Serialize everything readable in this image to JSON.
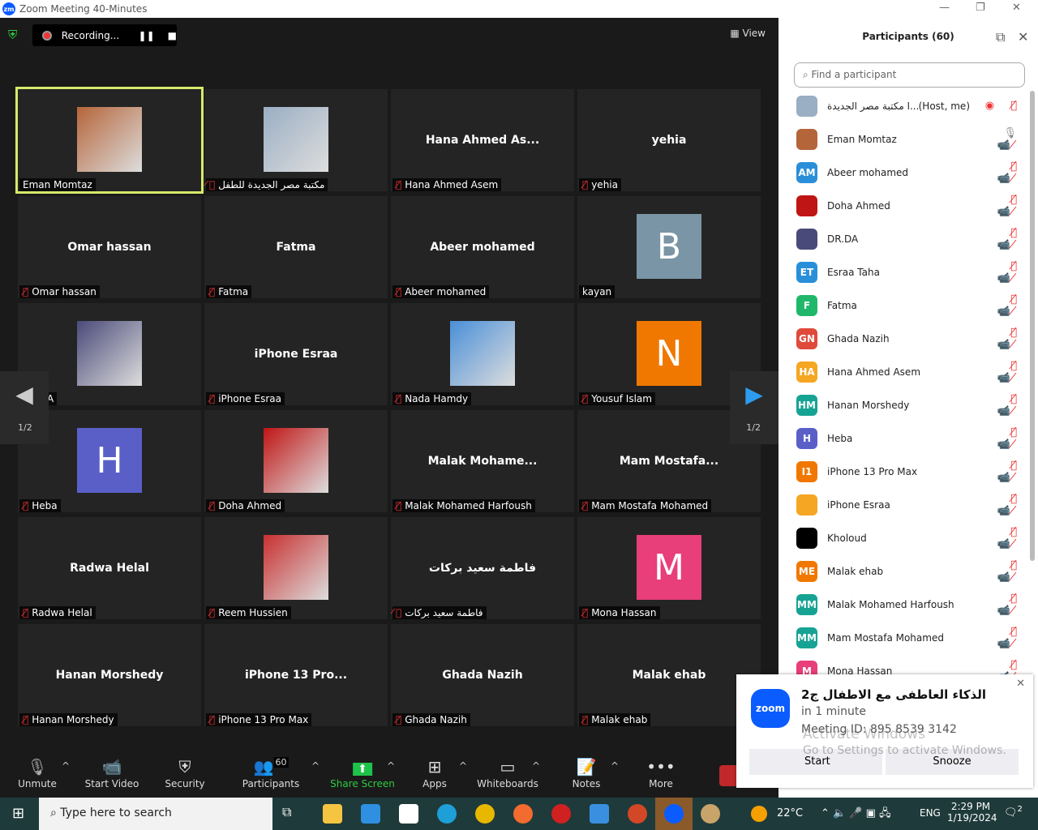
{
  "window": {
    "title": "Zoom Meeting 40-Minutes",
    "logo": "zm"
  },
  "topbar": {
    "recording": "Recording...",
    "view": "View"
  },
  "tiles": [
    {
      "label": "Eman Momtaz",
      "kind": "image",
      "color": "#b5653a",
      "active": true,
      "muted": false
    },
    {
      "label": "مكتبة مصر الجديدة للطفل",
      "kind": "image",
      "color": "#9aaec4",
      "muted": true
    },
    {
      "label": "Hana Ahmed Asem",
      "name": "Hana Ahmed As...",
      "kind": "name",
      "muted": true
    },
    {
      "label": "yehia",
      "name": "yehia",
      "kind": "name",
      "muted": true
    },
    {
      "label": "Omar hassan",
      "name": "Omar hassan",
      "kind": "name",
      "muted": true
    },
    {
      "label": "Fatma",
      "name": "Fatma",
      "kind": "name",
      "muted": true
    },
    {
      "label": "Abeer mohamed",
      "name": "Abeer mohamed",
      "kind": "name",
      "muted": true
    },
    {
      "label": "kayan",
      "kind": "letter",
      "letter": "B",
      "color": "#7a95a5",
      "muted": false
    },
    {
      "label": "DR.DA",
      "kind": "image",
      "color": "#4a4a7a",
      "muted": false
    },
    {
      "label": "iPhone Esraa",
      "name": "iPhone Esraa",
      "kind": "name",
      "muted": true
    },
    {
      "label": "Nada Hamdy",
      "kind": "image",
      "color": "#4a8fd8",
      "muted": true
    },
    {
      "label": "Yousuf Islam",
      "kind": "letter",
      "letter": "N",
      "color": "#f07800",
      "muted": true
    },
    {
      "label": "Heba",
      "kind": "letter",
      "letter": "H",
      "color": "#5a5fc8",
      "muted": true
    },
    {
      "label": "Doha Ahmed",
      "kind": "image",
      "color": "#c01515",
      "muted": true
    },
    {
      "label": "Malak Mohamed Harfoush",
      "name": "Malak  Mohame...",
      "kind": "name",
      "muted": true
    },
    {
      "label": "Mam Mostafa Mohamed",
      "name": "Mam  Mostafa...",
      "kind": "name",
      "muted": true
    },
    {
      "label": "Radwa Helal",
      "name": "Radwa Helal",
      "kind": "name",
      "muted": true
    },
    {
      "label": "Reem Hussien",
      "kind": "image",
      "color": "#c83030",
      "muted": true
    },
    {
      "label": "فاطمة سعيد بركات",
      "name": "فاطمة سعيد بركات",
      "kind": "name",
      "muted": true
    },
    {
      "label": "Mona Hassan",
      "kind": "letter",
      "letter": "M",
      "color": "#e83e7a",
      "muted": true
    },
    {
      "label": "Hanan Morshedy",
      "name": "Hanan Morshedy",
      "kind": "name",
      "muted": true
    },
    {
      "label": "iPhone 13 Pro Max",
      "name": "iPhone  13  Pro...",
      "kind": "name",
      "muted": true
    },
    {
      "label": "Ghada Nazih",
      "name": "Ghada Nazih",
      "kind": "name",
      "muted": true
    },
    {
      "label": "Malak ehab",
      "name": "Malak ehab",
      "kind": "name",
      "muted": true
    }
  ],
  "pager": {
    "left": "1/2",
    "right": "1/2"
  },
  "toolbar": [
    {
      "label": "Unmute",
      "icon": "mic-off-icon",
      "glyph": "🎙"
    },
    {
      "label": "Start Video",
      "icon": "video-off-icon",
      "glyph": "📹"
    },
    {
      "label": "Security",
      "icon": "shield-icon",
      "glyph": "⛨"
    },
    {
      "label": "Participants",
      "icon": "participants-icon",
      "glyph": "👥",
      "badge": "60"
    },
    {
      "label": "Share Screen",
      "icon": "share-screen-icon",
      "glyph": "⬆"
    },
    {
      "label": "Apps",
      "icon": "apps-icon",
      "glyph": "⊞"
    },
    {
      "label": "Whiteboards",
      "icon": "whiteboard-icon",
      "glyph": "▭"
    },
    {
      "label": "Notes",
      "icon": "notes-icon",
      "glyph": "📝"
    },
    {
      "label": "More",
      "icon": "more-icon",
      "glyph": "•••"
    }
  ],
  "participants": {
    "title": "Participants",
    "count": "(60)",
    "search_placeholder": "Find a participant",
    "items": [
      {
        "name": "ا مكتبة مصر الجديدة...",
        "tag": "(Host, me)",
        "initials": "",
        "color": "#9aaec4"
      },
      {
        "name": "Eman Momtaz",
        "initials": "",
        "color": "#b5653a"
      },
      {
        "name": "Abeer mohamed",
        "initials": "AM",
        "color": "#2a8fd8"
      },
      {
        "name": "Doha Ahmed",
        "initials": "",
        "color": "#c01515"
      },
      {
        "name": "DR.DA",
        "initials": "",
        "color": "#4a4a7a"
      },
      {
        "name": "Esraa Taha",
        "initials": "ET",
        "color": "#2a8fd8"
      },
      {
        "name": "Fatma",
        "initials": "F",
        "color": "#1fb86a"
      },
      {
        "name": "Ghada Nazih",
        "initials": "GN",
        "color": "#e04a3a"
      },
      {
        "name": "Hana Ahmed Asem",
        "initials": "HA",
        "color": "#f5a623"
      },
      {
        "name": "Hanan Morshedy",
        "initials": "HM",
        "color": "#16a394"
      },
      {
        "name": "Heba",
        "initials": "H",
        "color": "#5a5fc8"
      },
      {
        "name": "iPhone 13 Pro Max",
        "initials": "I1",
        "color": "#f07800"
      },
      {
        "name": "iPhone Esraa",
        "initials": "",
        "color": "#f5a623"
      },
      {
        "name": "Kholoud",
        "initials": "",
        "color": "#000000"
      },
      {
        "name": "Malak ehab",
        "initials": "ME",
        "color": "#f07800"
      },
      {
        "name": "Malak Mohamed Harfoush",
        "initials": "MM",
        "color": "#16a394"
      },
      {
        "name": "Mam Mostafa Mohamed",
        "initials": "MM",
        "color": "#16a394"
      },
      {
        "name": "Mona Hassan",
        "initials": "M",
        "color": "#e83e7a"
      }
    ]
  },
  "notification": {
    "title": "الذكاء العاطفى مع الاطفال ج2",
    "time": "in 1 minute",
    "meeting_id": "Meeting ID: 895 8539 3142",
    "start": "Start",
    "snooze": "Snooze",
    "logo": "zoom"
  },
  "watermark": {
    "line1": "Activate Windows",
    "line2": "Go to Settings to activate Windows."
  },
  "taskbar": {
    "search_placeholder": "Type here to search",
    "weather": "22°C",
    "lang": "ENG",
    "time": "2:29 PM",
    "date": "1/19/2024",
    "notif_count": "2"
  }
}
